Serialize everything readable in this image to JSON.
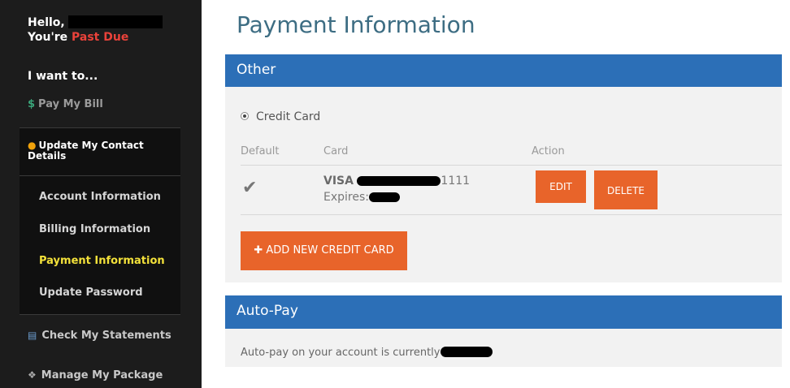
{
  "sidebar": {
    "greeting": "Hello,",
    "youre": "You're",
    "status": "Past Due",
    "i_want_to": "I want to...",
    "pay_bill": "Pay My Bill",
    "pay_bill_icon": "dollar-icon",
    "update_contact": "Update My Contact Details",
    "update_contact_icon": "person-icon",
    "sub_items": [
      {
        "label": "Account Information"
      },
      {
        "label": "Billing Information"
      },
      {
        "label": "Payment Information"
      },
      {
        "label": "Update Password"
      }
    ],
    "active_item": "Payment Information",
    "check_statements": "Check My Statements",
    "check_statements_icon": "statement-icon",
    "manage_package": "Manage My Package",
    "manage_package_icon": "package-icon"
  },
  "main": {
    "title": "Payment Information",
    "other_panel": {
      "header": "Other",
      "radio_label": "Credit Card",
      "columns": [
        "Default",
        "Card",
        "Action"
      ],
      "card": {
        "brand": "VISA",
        "last4": "1111",
        "expires_label": "Expires:",
        "is_default": true
      },
      "edit_label": "EDIT",
      "delete_label": "DELETE",
      "add_label": "ADD NEW CREDIT CARD"
    },
    "autopay_panel": {
      "header": "Auto-Pay",
      "text": "Auto-pay on your account is currently"
    }
  },
  "colors": {
    "sidebar_bg": "#1c1c1c",
    "panel_header": "#2c6fb7",
    "accent_button": "#e8642a",
    "past_due": "#e9423a",
    "active_nav": "#f3e13a"
  }
}
